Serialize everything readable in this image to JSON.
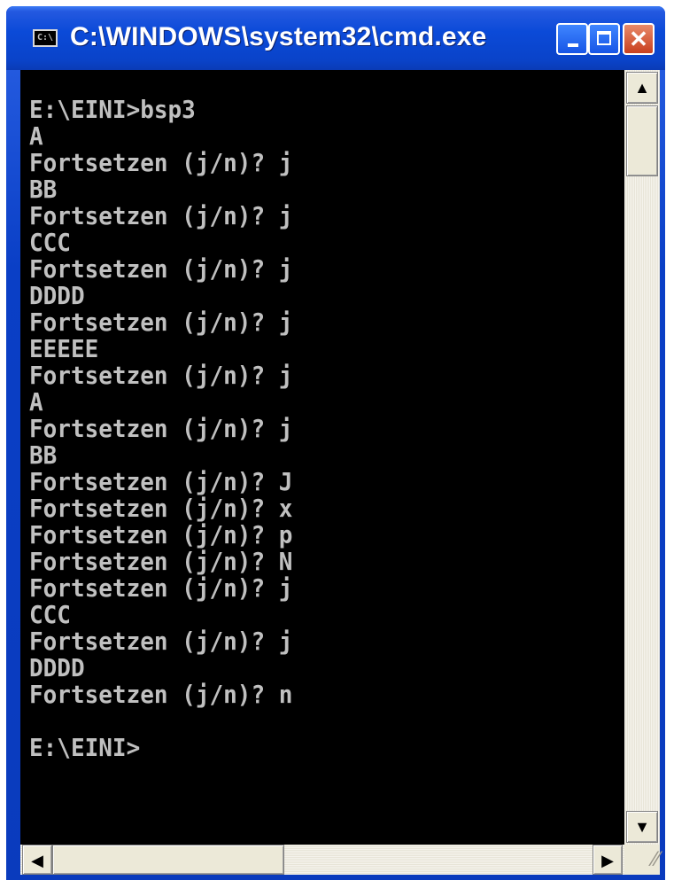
{
  "window": {
    "title": "C:\\WINDOWS\\system32\\cmd.exe",
    "system_icon_text": "C:\\"
  },
  "console": {
    "lines": [
      "",
      "E:\\EINI>bsp3",
      "A",
      "Fortsetzen (j/n)? j",
      "BB",
      "Fortsetzen (j/n)? j",
      "CCC",
      "Fortsetzen (j/n)? j",
      "DDDD",
      "Fortsetzen (j/n)? j",
      "EEEEE",
      "Fortsetzen (j/n)? j",
      "A",
      "Fortsetzen (j/n)? j",
      "BB",
      "Fortsetzen (j/n)? J",
      "Fortsetzen (j/n)? x",
      "Fortsetzen (j/n)? p",
      "Fortsetzen (j/n)? N",
      "Fortsetzen (j/n)? j",
      "CCC",
      "Fortsetzen (j/n)? j",
      "DDDD",
      "Fortsetzen (j/n)? n",
      "",
      "E:\\EINI>"
    ],
    "colors": {
      "background": "#000000",
      "text": "#c0c0c0"
    }
  },
  "scrollbars": {
    "up_icon": "arrow-up-icon",
    "down_icon": "arrow-down-icon",
    "left_icon": "arrow-left-icon",
    "right_icon": "arrow-right-icon"
  }
}
